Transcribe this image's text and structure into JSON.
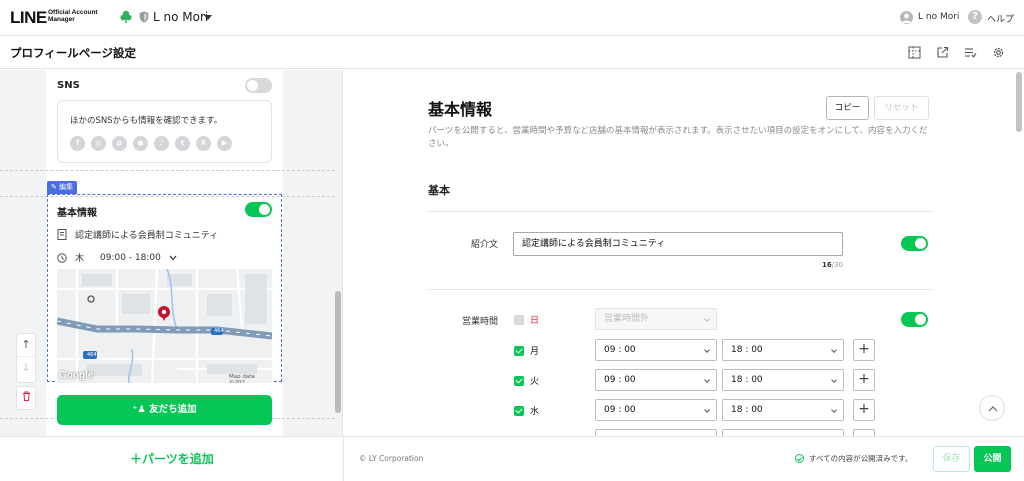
{
  "header": {
    "logo_main": "LINE",
    "logo_sub_line1": "Official Account",
    "logo_sub_line2": "Manager",
    "account_name": "L no Mori",
    "user_name": "L no Mori",
    "help_label": "ヘルプ"
  },
  "page": {
    "title": "プロフィールページ設定"
  },
  "preview": {
    "sns": {
      "title": "SNS",
      "enabled": false,
      "text": "ほかのSNSからも情報を確認できます。",
      "icons": [
        "facebook-icon",
        "instagram-icon",
        "pinterest-icon",
        "line-icon",
        "tiktok-icon",
        "tumblr-icon",
        "x-icon",
        "youtube-icon"
      ]
    },
    "edit_tag": "編集",
    "basic_info": {
      "title": "基本情報",
      "enabled": true,
      "intro": "認定講師による会員制コミュニティ",
      "day": "木",
      "hours": "09:00 - 18:00"
    },
    "map": {
      "provider": "Google",
      "credit": "Map data ©202",
      "road_number_1": "464",
      "road_number_2": "464"
    },
    "add_friend_label": "友だち追加"
  },
  "form": {
    "title": "基本情報",
    "copy_label": "コピー",
    "reset_label": "リセット",
    "description": "パーツを公開すると、営業時間や予算など店舗の基本情報が表示されます。表示させたい項目の設定をオンにして、内容を入力ください。",
    "section_title": "基本",
    "intro": {
      "label": "紹介文",
      "value": "認定講師による会員制コミュニティ",
      "count": "16",
      "max": "/30",
      "enabled": true
    },
    "hours": {
      "label": "営業時間",
      "enabled": true,
      "days": [
        {
          "day": "日",
          "checked": false,
          "closed_text": "営業時間外"
        },
        {
          "day": "月",
          "checked": true,
          "open": "09 : 00",
          "close": "18 : 00"
        },
        {
          "day": "火",
          "checked": true,
          "open": "09 : 00",
          "close": "18 : 00"
        },
        {
          "day": "水",
          "checked": true,
          "open": "09 : 00",
          "close": "18 : 00"
        }
      ]
    }
  },
  "footer": {
    "add_parts_label": "＋パーツを追加",
    "copyright": "© LY Corporation",
    "status_text": "すべての内容が公開済みです。",
    "save_label": "保存",
    "publish_label": "公開"
  },
  "colors": {
    "line_green": "#06c755",
    "edit_blue": "#4a6ee0",
    "sunday_red": "#e0243c"
  }
}
